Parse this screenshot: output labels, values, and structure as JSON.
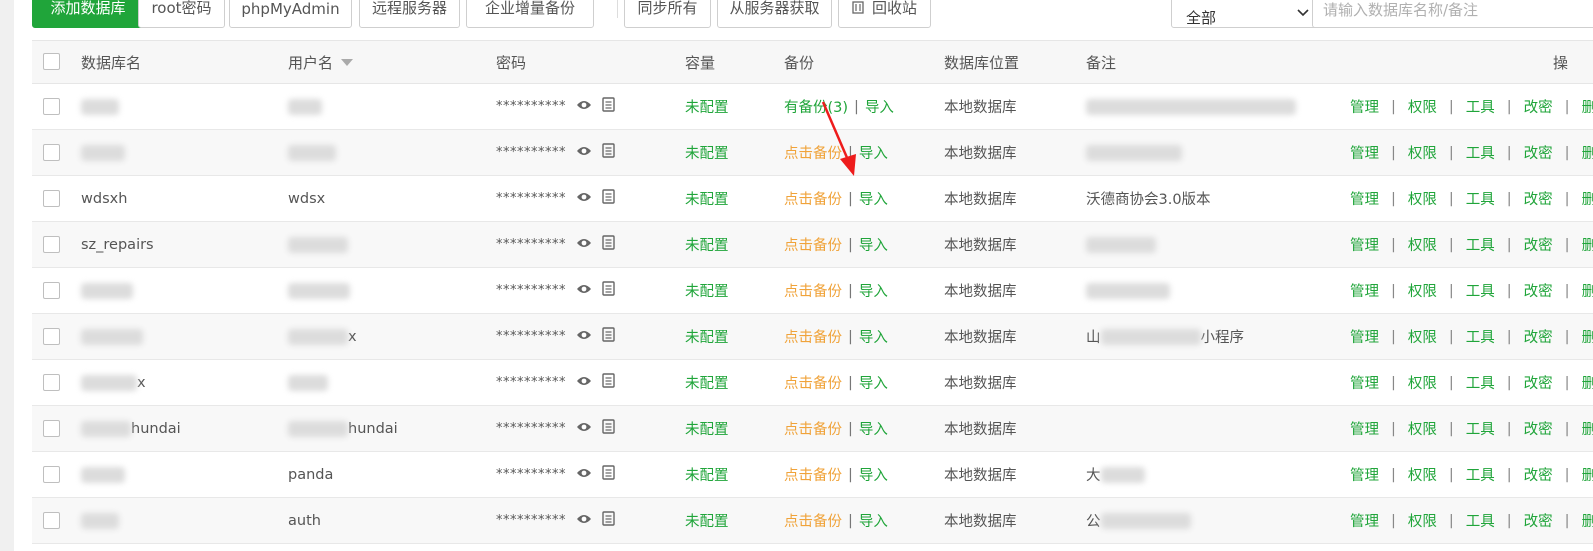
{
  "toolbar": {
    "buttons": [
      {
        "label": "添加数据库",
        "primary": true
      },
      {
        "label": "root密码"
      },
      {
        "label": "phpMyAdmin"
      },
      {
        "label": "远程服务器"
      },
      {
        "label": "企业增量备份"
      },
      {
        "label": "同步所有"
      },
      {
        "label": "从服务器获取"
      },
      {
        "label": "回收站"
      }
    ],
    "filter_value": "全部",
    "search_placeholder": "请输入数据库名称/备注"
  },
  "table": {
    "headers": {
      "name": "数据库名",
      "user": "用户名",
      "password": "密码",
      "capacity": "容量",
      "backup": "备份",
      "location": "数据库位置",
      "note": "备注",
      "ops": "操"
    },
    "rows": [
      {
        "name": "",
        "user": "",
        "password": "**********",
        "capacity": "未配置",
        "backup": "有备份(3)",
        "backup_ok": true,
        "import": "导入",
        "location": "本地数据库",
        "note": ""
      },
      {
        "name": "",
        "user": "",
        "password": "**********",
        "capacity": "未配置",
        "backup": "点击备份",
        "import": "导入",
        "location": "本地数据库",
        "note": ""
      },
      {
        "name": "wdsxh",
        "user": "wdsx",
        "password": "**********",
        "capacity": "未配置",
        "backup": "点击备份",
        "import": "导入",
        "location": "本地数据库",
        "note": "沃德商协会3.0版本"
      },
      {
        "name": "sz_repairs",
        "user": "",
        "password": "**********",
        "capacity": "未配置",
        "backup": "点击备份",
        "import": "导入",
        "location": "本地数据库",
        "note": ""
      },
      {
        "name": "",
        "user": "",
        "password": "**********",
        "capacity": "未配置",
        "backup": "点击备份",
        "import": "导入",
        "location": "本地数据库",
        "note": ""
      },
      {
        "name": "",
        "user": "x",
        "password": "**********",
        "capacity": "未配置",
        "backup": "点击备份",
        "import": "导入",
        "location": "本地数据库",
        "note": "山",
        "note_suffix": "小程序"
      },
      {
        "name": "x",
        "user": "",
        "password": "**********",
        "capacity": "未配置",
        "backup": "点击备份",
        "import": "导入",
        "location": "本地数据库",
        "note": ""
      },
      {
        "name": "hundai",
        "user": "hundai",
        "password": "**********",
        "capacity": "未配置",
        "backup": "点击备份",
        "import": "导入",
        "location": "本地数据库",
        "note": ""
      },
      {
        "name": "",
        "user": "panda",
        "password": "**********",
        "capacity": "未配置",
        "backup": "点击备份",
        "import": "导入",
        "location": "本地数据库",
        "note": "大"
      },
      {
        "name": "",
        "user": "auth",
        "password": "**********",
        "capacity": "未配置",
        "backup": "点击备份",
        "import": "导入",
        "location": "本地数据库",
        "note": "公"
      }
    ],
    "ops": [
      "管理",
      "权限",
      "工具",
      "改密",
      "删"
    ]
  },
  "colors": {
    "accent": "#20a53a",
    "backup_orange": "#f0a33a",
    "annotation_arrow": "#ee1c1c"
  },
  "icons": {
    "eye": "eye-icon",
    "copy": "copy-icon",
    "trash": "trash-icon",
    "chevron": "chevron-down-icon",
    "sort": "sort-caret-icon"
  }
}
